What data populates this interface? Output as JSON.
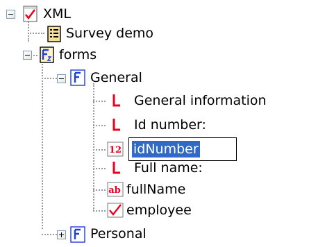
{
  "tree": {
    "root": {
      "label": "XML",
      "icon": "xml-document-icon",
      "state": "expanded"
    },
    "survey": {
      "label": "Survey demo",
      "icon": "survey-form-icon"
    },
    "forms": {
      "label": "forms",
      "icon": "forms-folder-icon",
      "state": "expanded"
    },
    "general": {
      "label": "General",
      "icon": "form-f-icon",
      "state": "expanded"
    },
    "general_information": {
      "label": "General information",
      "icon": "label-l-icon"
    },
    "id_number_label": {
      "label": "Id number:",
      "icon": "label-l-icon"
    },
    "id_number_field": {
      "label": "idNumber",
      "icon": "numeric-field-icon",
      "editing": true
    },
    "full_name_label": {
      "label": "Full name:",
      "icon": "label-l-icon"
    },
    "full_name_field": {
      "label": "fullName",
      "icon": "text-field-icon"
    },
    "employee": {
      "label": "employee",
      "icon": "checkbox-icon"
    },
    "personal": {
      "label": "Personal",
      "icon": "form-f-icon",
      "state": "collapsed"
    }
  },
  "icon_glyphs": {
    "numeric_field": "12",
    "text_field": "ab"
  },
  "colors": {
    "selection": "#316ac5",
    "icon_red": "#e8001c",
    "form_blue": "#1c3fd6",
    "tree_lines": "#9a9a9a"
  }
}
